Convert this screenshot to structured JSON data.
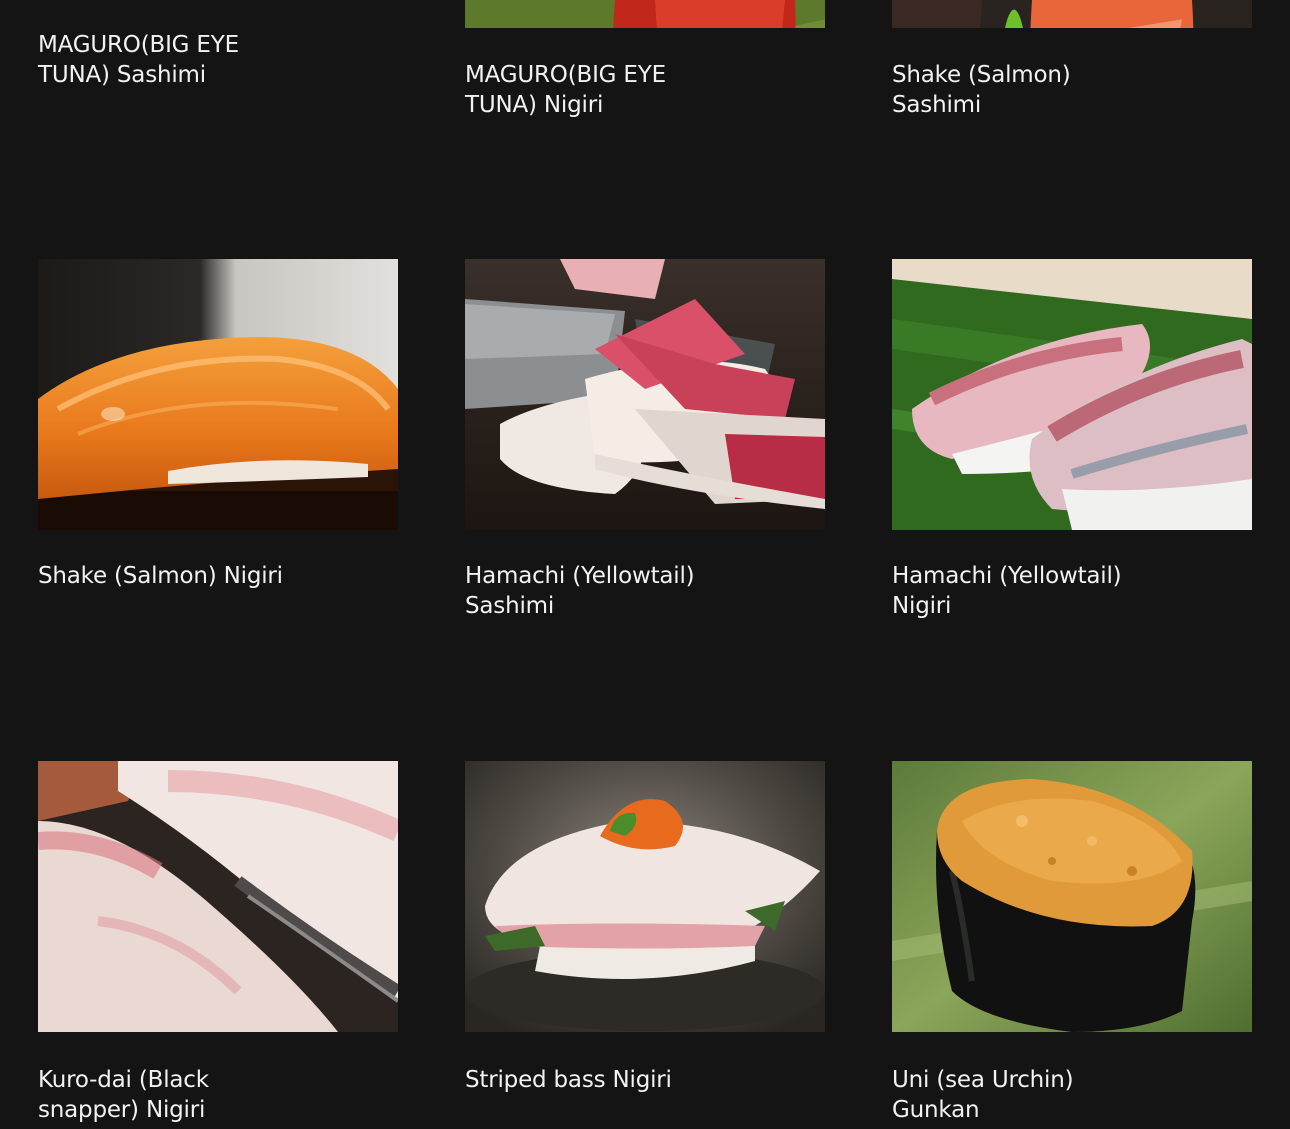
{
  "menu": {
    "items": [
      {
        "name": "MAGURO(BIG EYE TUNA) Sashimi",
        "line1": "MAGURO(BIG EYE",
        "line2": "TUNA) Sashimi"
      },
      {
        "name": "MAGURO(BIG EYE TUNA) Nigiri",
        "line1": "MAGURO(BIG EYE",
        "line2": "TUNA) Nigiri"
      },
      {
        "name": "Shake (Salmon) Sashimi",
        "line1": "Shake (Salmon)",
        "line2": "Sashimi"
      },
      {
        "name": "Shake (Salmon) Nigiri",
        "line1": "Shake (Salmon) Nigiri",
        "line2": ""
      },
      {
        "name": "Hamachi (Yellowtail) Sashimi",
        "line1": "Hamachi (Yellowtail)",
        "line2": "Sashimi"
      },
      {
        "name": "Hamachi (Yellowtail) Nigiri",
        "line1": "Hamachi (Yellowtail)",
        "line2": "Nigiri"
      },
      {
        "name": "Kuro-dai (Black snapper) Nigiri",
        "line1": "Kuro-dai (Black",
        "line2": "snapper) Nigiri"
      },
      {
        "name": "Striped bass Nigiri",
        "line1": "Striped bass Nigiri",
        "line2": ""
      },
      {
        "name": "Uni (sea Urchin) Gunkan",
        "line1": "Uni (sea Urchin)",
        "line2": "Gunkan"
      }
    ]
  },
  "colors": {
    "background": "#141414",
    "text": "#f2f2f2"
  }
}
